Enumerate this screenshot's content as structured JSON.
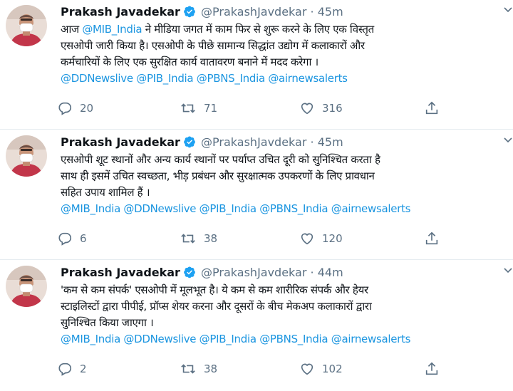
{
  "tweets": [
    {
      "name": "Prakash Javadekar",
      "handle": "@PrakashJavdekar",
      "dot": "·",
      "time": "45m",
      "lines": [
        {
          "pre": "आज ",
          "mention": "@MIB_India",
          "post": " ने मीडिया जगत में काम फिर से शुरू करने के लिए एक विस्तृत"
        },
        {
          "pre": "एसओपी जारी किया है। एसओपी के पीछे सामान्य सिद्धांत उद्योग में कलाकारों और",
          "mention": "",
          "post": ""
        },
        {
          "pre": "कर्मचारियों के लिए एक सुरक्षित कार्य वातावरण बनाने में मदद करेगा ।",
          "mention": "",
          "post": ""
        }
      ],
      "mentions": "@DDNewslive @PIB_India @PBNS_India @airnewsalerts",
      "replies": "20",
      "retweets": "71",
      "likes": "316"
    },
    {
      "name": "Prakash Javadekar",
      "handle": "@PrakashJavdekar",
      "dot": "·",
      "time": "45m",
      "lines": [
        {
          "pre": "एसओपी शूट स्थानों और अन्य कार्य स्थानों पर पर्याप्त उचित दूरी को सुनिश्चित करता है",
          "mention": "",
          "post": ""
        },
        {
          "pre": "साथ ही इसमें उचित स्वच्छता, भीड़ प्रबंधन और सुरक्षात्मक उपकरणों के लिए प्रावधान",
          "mention": "",
          "post": ""
        },
        {
          "pre": "सहित उपाय शामिल हैं ।",
          "mention": "",
          "post": ""
        }
      ],
      "mentions": "@MIB_India @DDNewslive @PIB_India @PBNS_India @airnewsalerts",
      "replies": "6",
      "retweets": "38",
      "likes": "120"
    },
    {
      "name": "Prakash Javadekar",
      "handle": "@PrakashJavdekar",
      "dot": "·",
      "time": "44m",
      "lines": [
        {
          "pre": "'कम से कम संपर्क' एसओपी में मूलभूत है। ये कम से कम शारीरिक संपर्क और हेयर",
          "mention": "",
          "post": ""
        },
        {
          "pre": "स्टाइलिस्टों द्वारा पीपीई, प्रॉप्स शेयर करना और दूसरों के बीच मेकअप कलाकारों द्वारा",
          "mention": "",
          "post": ""
        },
        {
          "pre": "सुनिश्चित किया जाएगा ।",
          "mention": "",
          "post": ""
        }
      ],
      "mentions": "@MIB_India @DDNewslive @PIB_India @PBNS_India @airnewsalerts",
      "replies": "2",
      "retweets": "38",
      "likes": "102"
    }
  ],
  "icons": {
    "reply": "reply-icon",
    "retweet": "retweet-icon",
    "like": "like-icon",
    "share": "share-icon",
    "verified": "verified-badge-icon",
    "caret": "more-options-caret-icon"
  },
  "colors": {
    "accent": "#1b95e0",
    "verified": "#1da1f2",
    "muted": "#5b7083",
    "text": "#0f1419"
  }
}
